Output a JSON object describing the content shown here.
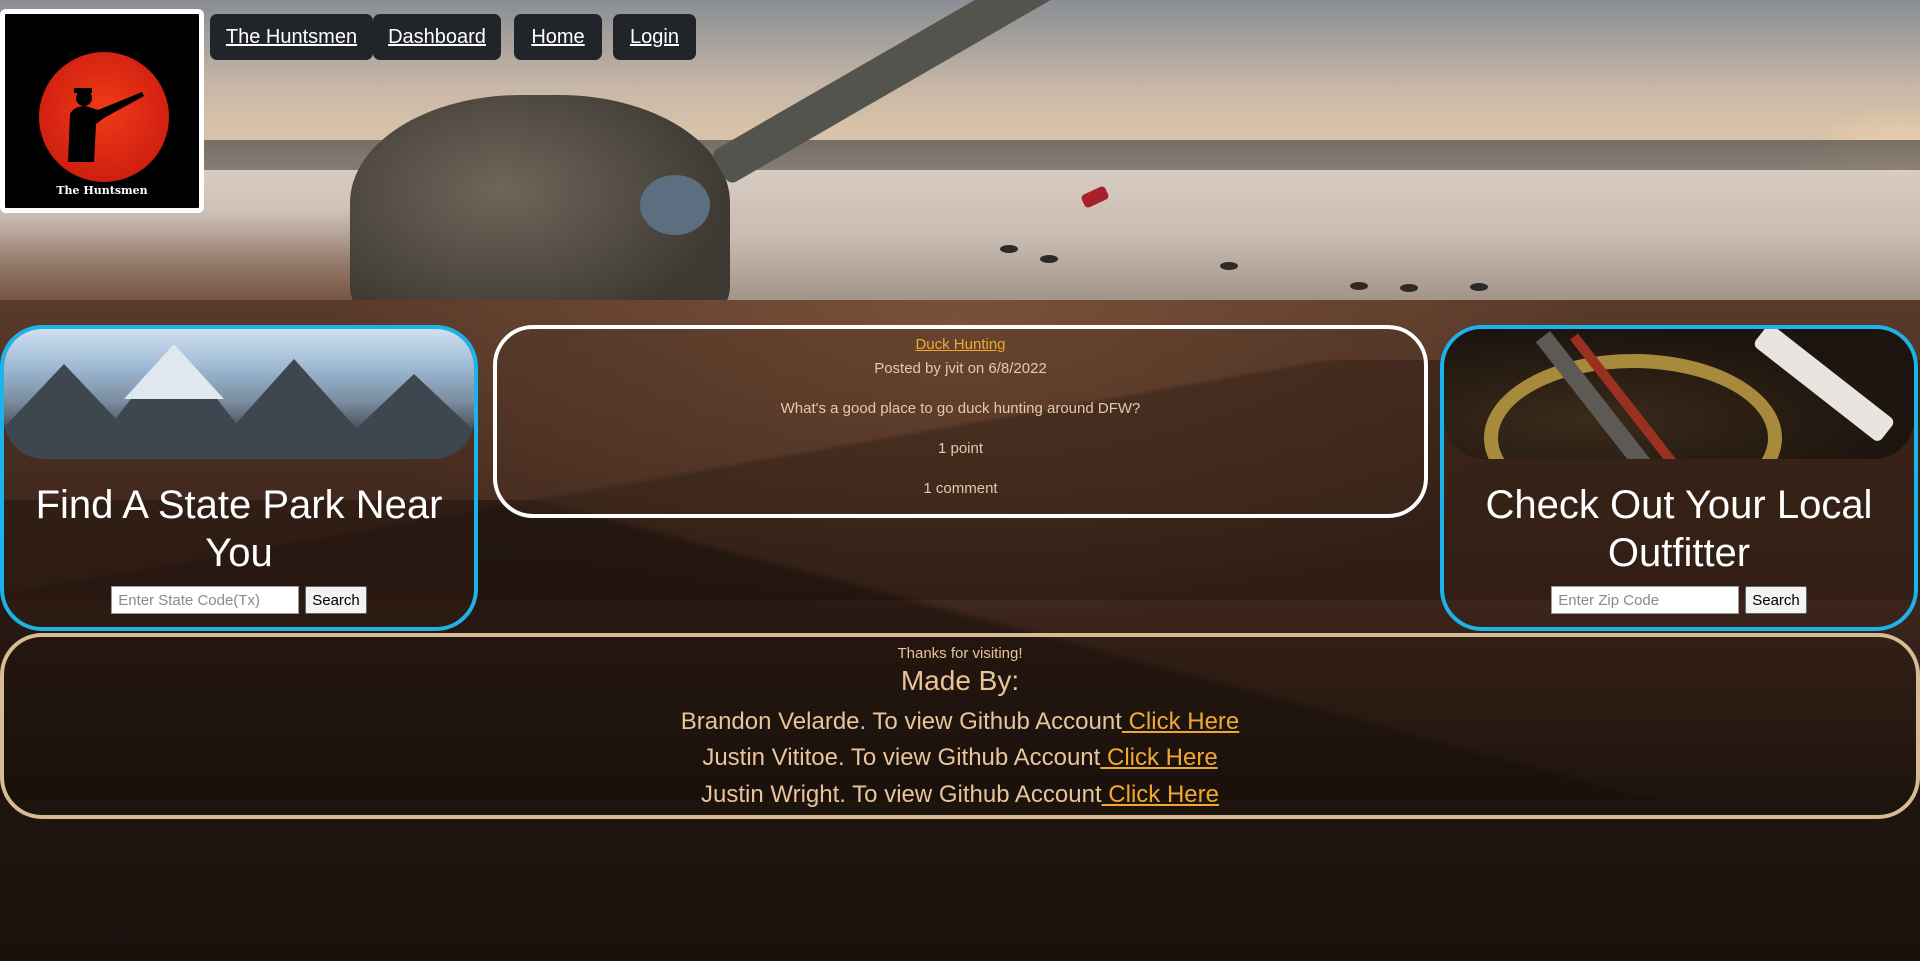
{
  "logo": {
    "text": "The Huntsmen"
  },
  "nav": {
    "items": [
      {
        "label": "The Huntsmen"
      },
      {
        "label": "Dashboard"
      },
      {
        "label": "Home"
      },
      {
        "label": "Login"
      }
    ]
  },
  "state_park": {
    "title": "Find A State Park Near You",
    "input_placeholder": "Enter State Code(Tx)",
    "button_label": "Search"
  },
  "outfitter": {
    "title": "Check Out Your Local Outfitter",
    "input_placeholder": "Enter Zip Code",
    "button_label": "Search"
  },
  "post": {
    "title": "Duck Hunting",
    "meta": "Posted by jvit on 6/8/2022",
    "body": "What's a good place to go duck hunting around DFW?",
    "points": "1 point",
    "comments": "1 comment"
  },
  "footer": {
    "thanks": "Thanks for visiting!",
    "made_by": "Made By:",
    "credits": [
      {
        "text": "Brandon Velarde. To view Github Account",
        "link": " Click Here"
      },
      {
        "text": "Justin Vititoe. To view Github Account",
        "link": " Click Here"
      },
      {
        "text": "Justin Wright. To view Github Account",
        "link": " Click Here"
      }
    ]
  },
  "colors": {
    "nav_bg": "#212529",
    "card_border_blue": "#1bb3e8",
    "footer_border": "#d6bb94",
    "link": "#f0a830",
    "logo_sun": "#e02a14"
  }
}
